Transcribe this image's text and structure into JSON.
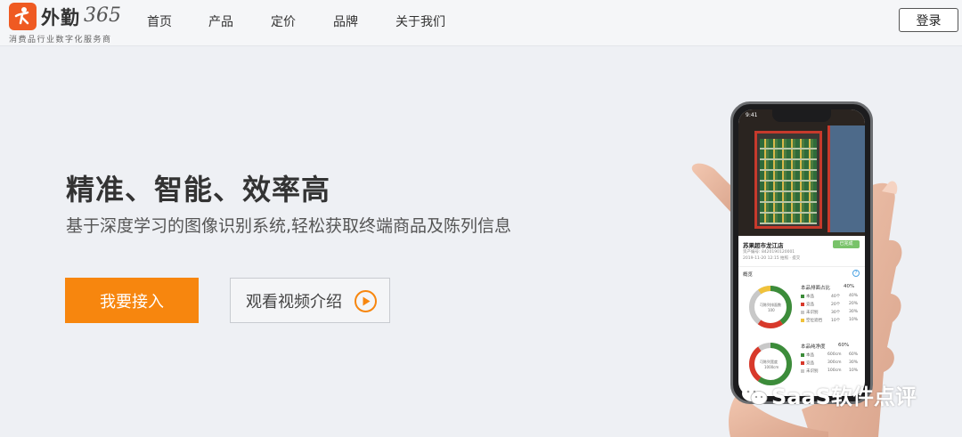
{
  "header": {
    "brand_name": "外勤",
    "brand_number": "365",
    "slogan": "消费品行业数字化服务商",
    "nav": [
      "首页",
      "产品",
      "定价",
      "品牌",
      "关于我们"
    ],
    "login_label": "登录"
  },
  "hero": {
    "title": "精准、智能、效率高",
    "subtitle": "基于深度学习的图像识别系统,轻松获取终端商品及陈列信息",
    "primary_button": "我要接入",
    "secondary_button": "观看视频介绍"
  },
  "phone": {
    "status_time": "9:41",
    "store_name": "苏果超市龙江店",
    "store_tag": "已完成",
    "store_id": "资产编号: 8420190120001",
    "store_time": "2019-11-20 12:15 拍照 · 提交",
    "section_label": "概览",
    "metric1": {
      "title": "本品排面占比",
      "percent": "40%",
      "center_label": "可陈列排面数",
      "center_value": "100",
      "legend": [
        {
          "name": "本品",
          "count": "40个",
          "pct": "40%"
        },
        {
          "name": "竞品",
          "count": "20个",
          "pct": "20%"
        },
        {
          "name": "未识别",
          "count": "30个",
          "pct": "30%"
        },
        {
          "name": "空位遮挡",
          "count": "10个",
          "pct": "10%"
        }
      ]
    },
    "metric2": {
      "title": "本品纯净度",
      "percent": "60%",
      "center_label": "可陈列宽度",
      "center_value": "1000cm",
      "legend": [
        {
          "name": "本品",
          "count": "600cm",
          "pct": "60%"
        },
        {
          "name": "竞品",
          "count": "300cm",
          "pct": "30%"
        },
        {
          "name": "未识别",
          "count": "100cm",
          "pct": "10%"
        }
      ]
    }
  },
  "watermark": {
    "text": "SaaS软件点评"
  },
  "colors": {
    "accent": "#f7860e",
    "logo": "#ef5a22",
    "green": "#3c8c3a",
    "red": "#d8392b",
    "yellow": "#f0c23a",
    "gray": "#c8c8c8"
  }
}
